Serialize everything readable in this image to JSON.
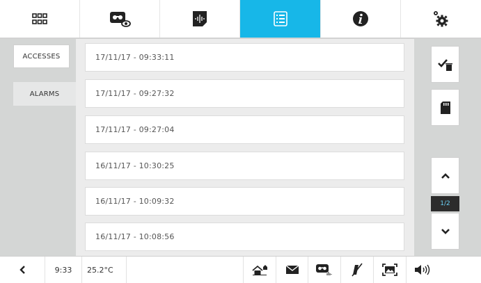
{
  "tabs": [
    {
      "icon": "apps-grid-icon"
    },
    {
      "icon": "video-memory-icon"
    },
    {
      "icon": "audio-memory-icon"
    },
    {
      "icon": "list-icon",
      "active": true
    },
    {
      "icon": "info-icon"
    },
    {
      "icon": "settings-icon"
    }
  ],
  "sidebar": {
    "accesses_label": "ACCESSES",
    "alarms_label": "ALARMS"
  },
  "entries": [
    "17/11/17 - 09:33:11",
    "17/11/17 - 09:27:32",
    "17/11/17 - 09:27:04",
    "16/11/17 - 10:30:25",
    "16/11/17 - 10:09:32",
    "16/11/17 - 10:08:56"
  ],
  "pager": {
    "page_label": "1/2"
  },
  "status": {
    "time": "9:33",
    "temperature": "25.2°C"
  },
  "colors": {
    "accent": "#17b7e8",
    "page_indicator_bg": "#2c2c2c",
    "page_indicator_text": "#6ad0f5"
  }
}
